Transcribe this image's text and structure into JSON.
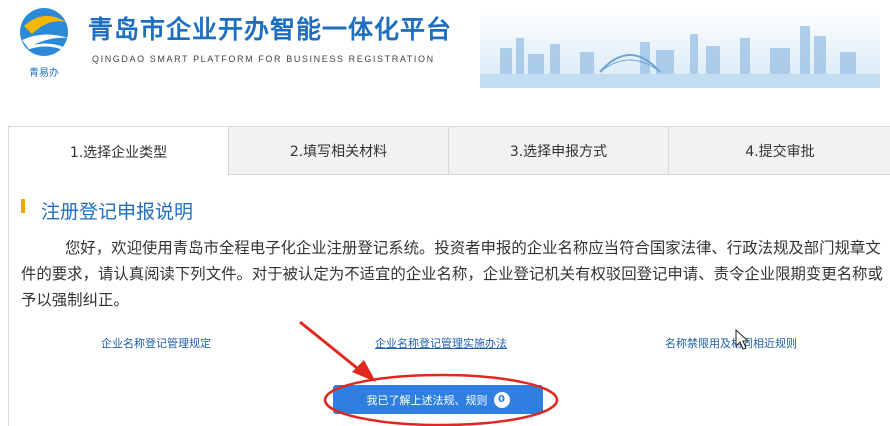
{
  "header": {
    "title": "青岛市企业开办智能一体化平台",
    "subtitle": "QINGDAO SMART PLATFORM FOR BUSINESS REGISTRATION",
    "logo_caption": "青易办",
    "brand_color": "#1f6fc1"
  },
  "tabs": [
    {
      "label": "1.选择企业类型",
      "active": true
    },
    {
      "label": "2.填写相关材料",
      "active": false
    },
    {
      "label": "3.选择申报方式",
      "active": false
    },
    {
      "label": "4.提交审批",
      "active": false
    }
  ],
  "section": {
    "title": "注册登记申报说明",
    "marker_color": "#f0a500"
  },
  "notice_text": "您好，欢迎使用青岛市全程电子化企业注册登记系统。投资者申报的企业名称应当符合国家法律、行政法规及部门规章文件的要求，请认真阅读下列文件。对于被认定为不适宜的企业名称，企业登记机关有权驳回登记申请、责令企业限期变更名称或予以强制纠正。",
  "links": [
    {
      "label": "企业名称登记管理规定"
    },
    {
      "label": "企业名称登记管理实施办法"
    },
    {
      "label": "名称禁限用及相同相近规则"
    }
  ],
  "confirm_button": {
    "label": "我已了解上述法规、规则",
    "countdown": "0",
    "color": "#2e7fe0"
  },
  "annotation_color": "#e0281e",
  "icons": [
    "logo-icon",
    "skyline-image",
    "mouse-cursor-icon",
    "annotation-arrow",
    "annotation-ellipse"
  ]
}
